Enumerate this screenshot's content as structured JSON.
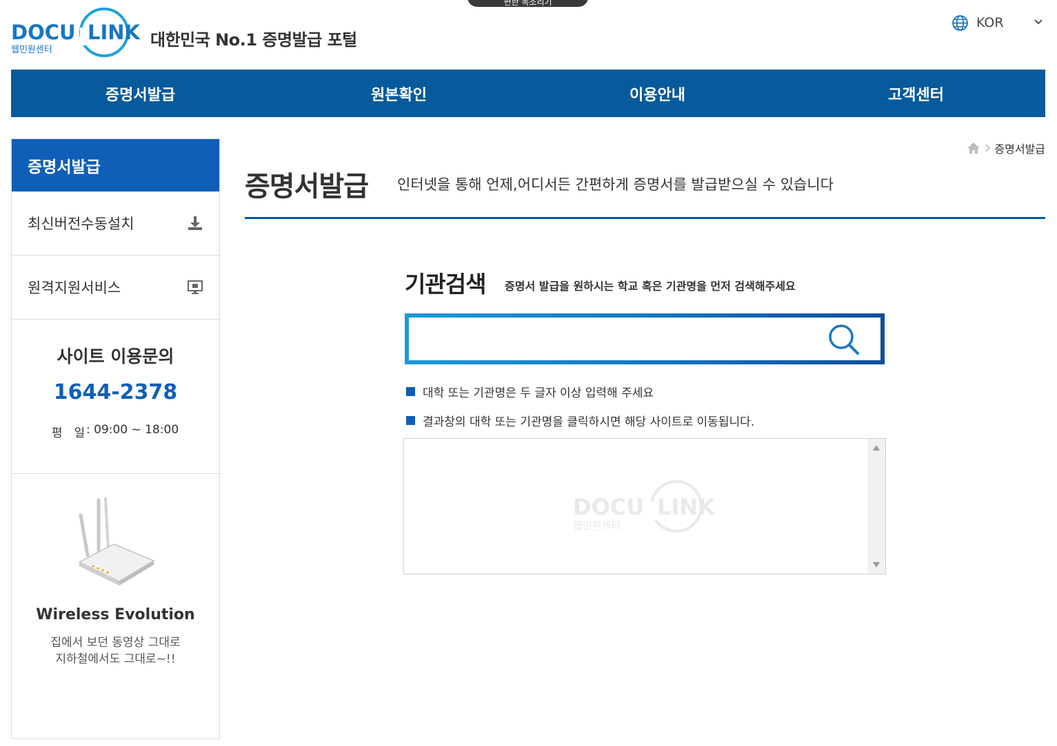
{
  "header": {
    "top_pill_label": "편한 목소리기",
    "logo": {
      "brand_left": "DOCU",
      "brand_right": "LINK",
      "sub": "웹민원센터"
    },
    "tagline": "대한민국 No.1 증명발급 포털",
    "language": {
      "label": "KOR"
    }
  },
  "gnb": {
    "items": [
      {
        "label": "증명서발급"
      },
      {
        "label": "원본확인"
      },
      {
        "label": "이용안내"
      },
      {
        "label": "고객센터"
      }
    ]
  },
  "sidebar": {
    "title": "증명서발급",
    "items": [
      {
        "label": "최신버전수동설치",
        "icon": "download-icon"
      },
      {
        "label": "원격지원서비스",
        "icon": "monitor-icon"
      }
    ],
    "inquiry": {
      "title": "사이트 이용문의",
      "phone": "1644-2378",
      "hours_label": "평　일",
      "hours_value": ": 09:00 ~ 18:00"
    },
    "banner": {
      "title": "Wireless Evolution",
      "line1": "집에서 보던 동영상 그대로",
      "line2": "지하철에서도 그대로~!!"
    }
  },
  "breadcrumb": {
    "current": "증명서발급"
  },
  "main": {
    "title": "증명서발급",
    "description": "인터넷을 통해 언제,어디서든 간편하게 증명서를 발급받으실 수 있습니다",
    "search": {
      "title": "기관검색",
      "subtitle": "증명서 발급을 원하시는 학교 혹은 기관명을 먼저 검색해주세요",
      "value": "",
      "placeholder": ""
    },
    "notes": [
      "대학 또는 기관명은 두 글자 이상 입력해 주세요",
      "결과창의 대학 또는 기관명을 클릭하시면 해당 사이트로 이동됩니다."
    ]
  },
  "colors": {
    "nav": "#075a9c",
    "accent": "#0f5fb8"
  }
}
